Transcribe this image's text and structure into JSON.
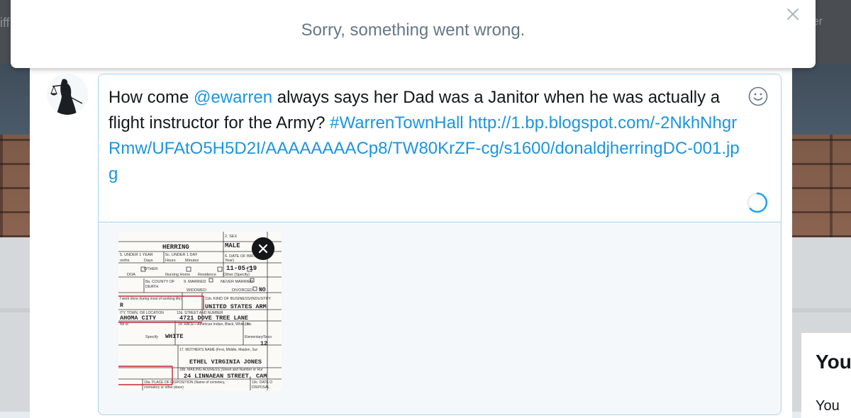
{
  "background": {
    "nav_left_fragment": "iff",
    "nav_right_fragment": "er",
    "side_card_heading": "You",
    "side_card_text": "You"
  },
  "toast": {
    "message": "Sorry, something went wrong.",
    "close_icon": "close-icon"
  },
  "compose": {
    "avatar_icon": "scales-of-justice-avatar",
    "text_parts": {
      "before_mention": "How come ",
      "mention": "@ewarren",
      "middle": " always says her Dad was a Janitor when he was actually a flight instructor for the Army? ",
      "hashtag": "#WarrenTownHall",
      "space": " ",
      "url": "http://1.bp.blogspot.com/-2NkhNhgrRmw/UFAtO5H5D2I/AAAAAAAACp8/TW80KrZF-cg/s1600/donaldjherringDC-001.jpg"
    },
    "emoji_icon": "smiley-icon",
    "progress_icon": "character-count-spinner",
    "media": {
      "remove_icon": "close-icon",
      "doc": {
        "sex_label": "2. SEX",
        "name": "HERRING",
        "sex_value": "MALE",
        "row_under1yr": "5. UNDER 1 YEAR",
        "row_under1day": "5c. UNDER 1 DAY",
        "row_dob": "6. DATE OF BIRTH",
        "dob_value": "11-05-19",
        "onths": "onths",
        "days": "Days",
        "hours": "Hours",
        "minutes": "Minutes",
        "year": "Year)",
        "doa": "DOA",
        "other": "OTHER:",
        "nursing": "Nursing Home",
        "residence": "Residence",
        "other_specify": "Other (Specify)",
        "county": "8a. COUNTY OF",
        "death": "DEATH",
        "married": "9. MARRIED",
        "never_married": "NEVER MARRIED",
        "widowed": "WIDOWED",
        "divorced": "DIVORCED",
        "no": "NO",
        "work_note": "f work done during most of working life)",
        "kind_business": "11b. KIND OF BUSINESS/INDUSTRY",
        "r_frag": "R",
        "business_value": "UNITED STATES ARM",
        "town_label": "ITY, TOWN, OR LOCATION",
        "street_label": "12d. STREET AND NUMBER",
        "city_value": "AHOMA CITY",
        "street_value": "4721 DOVE TREE LANE",
        "race_label": "14. RACE—American Indian, Black, White, etc.",
        "no_or": "No or",
        "item15": "15.",
        "specify": "Specify",
        "white": "WHITE",
        "elementary": "Elementary/Seco",
        "grade": "12",
        "mother_label": "17. MOTHER'S NAME (First, Middle, Maiden, Sur",
        "mother_value": "ETHEL VIRGINIA JONES",
        "mailing_label": "18b. MAILING ADDRESS (Street and Number or Rur",
        "mailing_value": "24 LINNAEAN STREET, CAM",
        "disposition_label": "19a. PLACE OF DISPOSITION (Name of cemetery,",
        "date_label": "19c. DATE O",
        "disposal": "DISPOSAL",
        "crematory": "crematory or other place)"
      }
    }
  }
}
